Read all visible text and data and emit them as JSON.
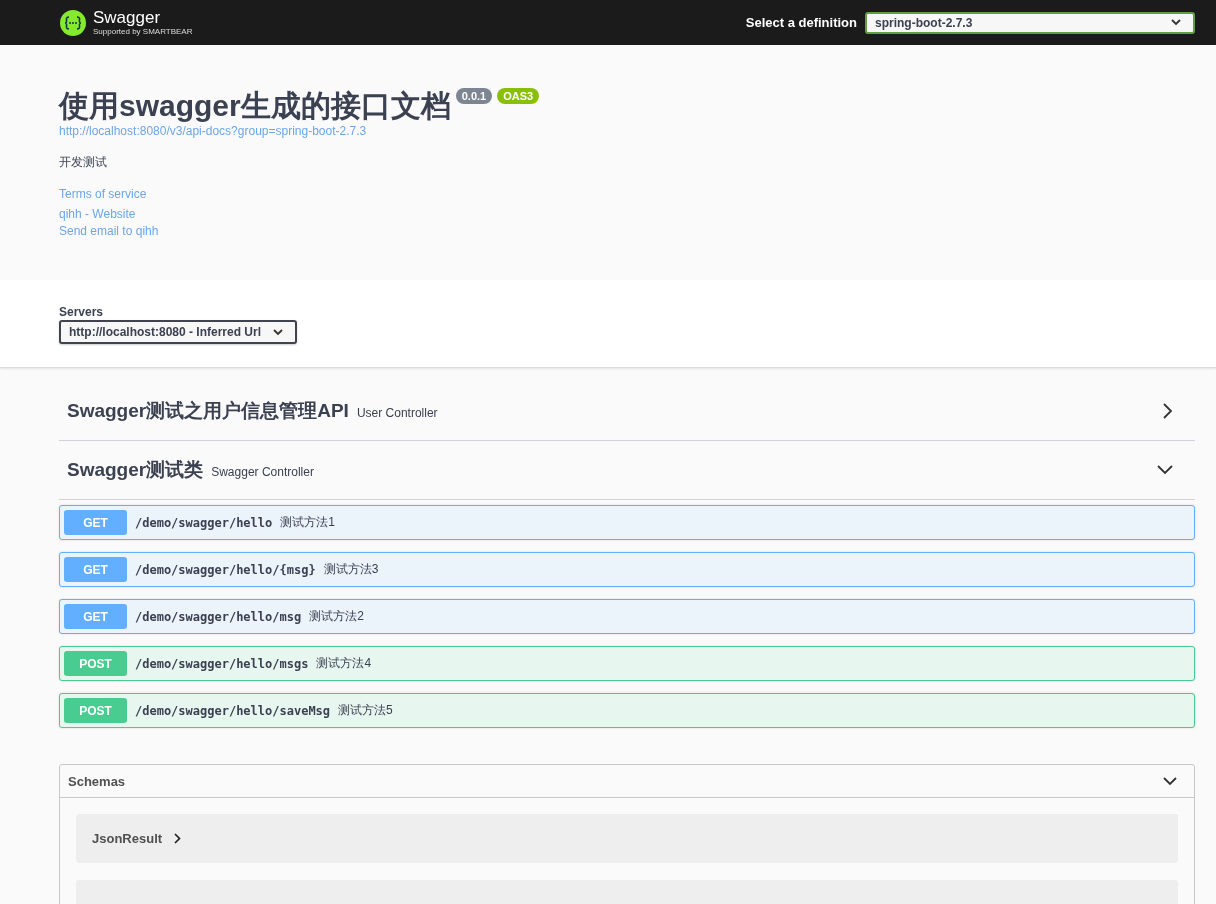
{
  "topbar": {
    "brand": "Swagger",
    "brand_sub": "Supported by SMARTBEAR",
    "definition_label": "Select a definition",
    "definition_value": "spring-boot-2.7.3"
  },
  "info": {
    "title": "使用swagger生成的接口文档",
    "version": "0.0.1",
    "oas": "OAS3",
    "url": "http://localhost:8080/v3/api-docs?group=spring-boot-2.7.3",
    "description": "开发测试",
    "links": [
      "Terms of service",
      "qihh - Website",
      "Send email to qihh"
    ]
  },
  "servers": {
    "label": "Servers",
    "value": "http://localhost:8080 - Inferred Url"
  },
  "tags": [
    {
      "name": "Swagger测试之用户信息管理API",
      "description": "User Controller",
      "expanded": false
    },
    {
      "name": "Swagger测试类",
      "description": "Swagger Controller",
      "expanded": true,
      "operations": [
        {
          "method": "GET",
          "path": "/demo/swagger/hello",
          "summary": "测试方法1"
        },
        {
          "method": "GET",
          "path": "/demo/swagger/hello/{msg}",
          "summary": "测试方法3"
        },
        {
          "method": "GET",
          "path": "/demo/swagger/hello/msg",
          "summary": "测试方法2"
        },
        {
          "method": "POST",
          "path": "/demo/swagger/hello/msgs",
          "summary": "测试方法4"
        },
        {
          "method": "POST",
          "path": "/demo/swagger/hello/saveMsg",
          "summary": "测试方法5"
        }
      ]
    }
  ],
  "schemas": {
    "title": "Schemas",
    "expanded": true,
    "items": [
      {
        "name": "JsonResult"
      },
      {
        "kind": "cut"
      }
    ]
  }
}
